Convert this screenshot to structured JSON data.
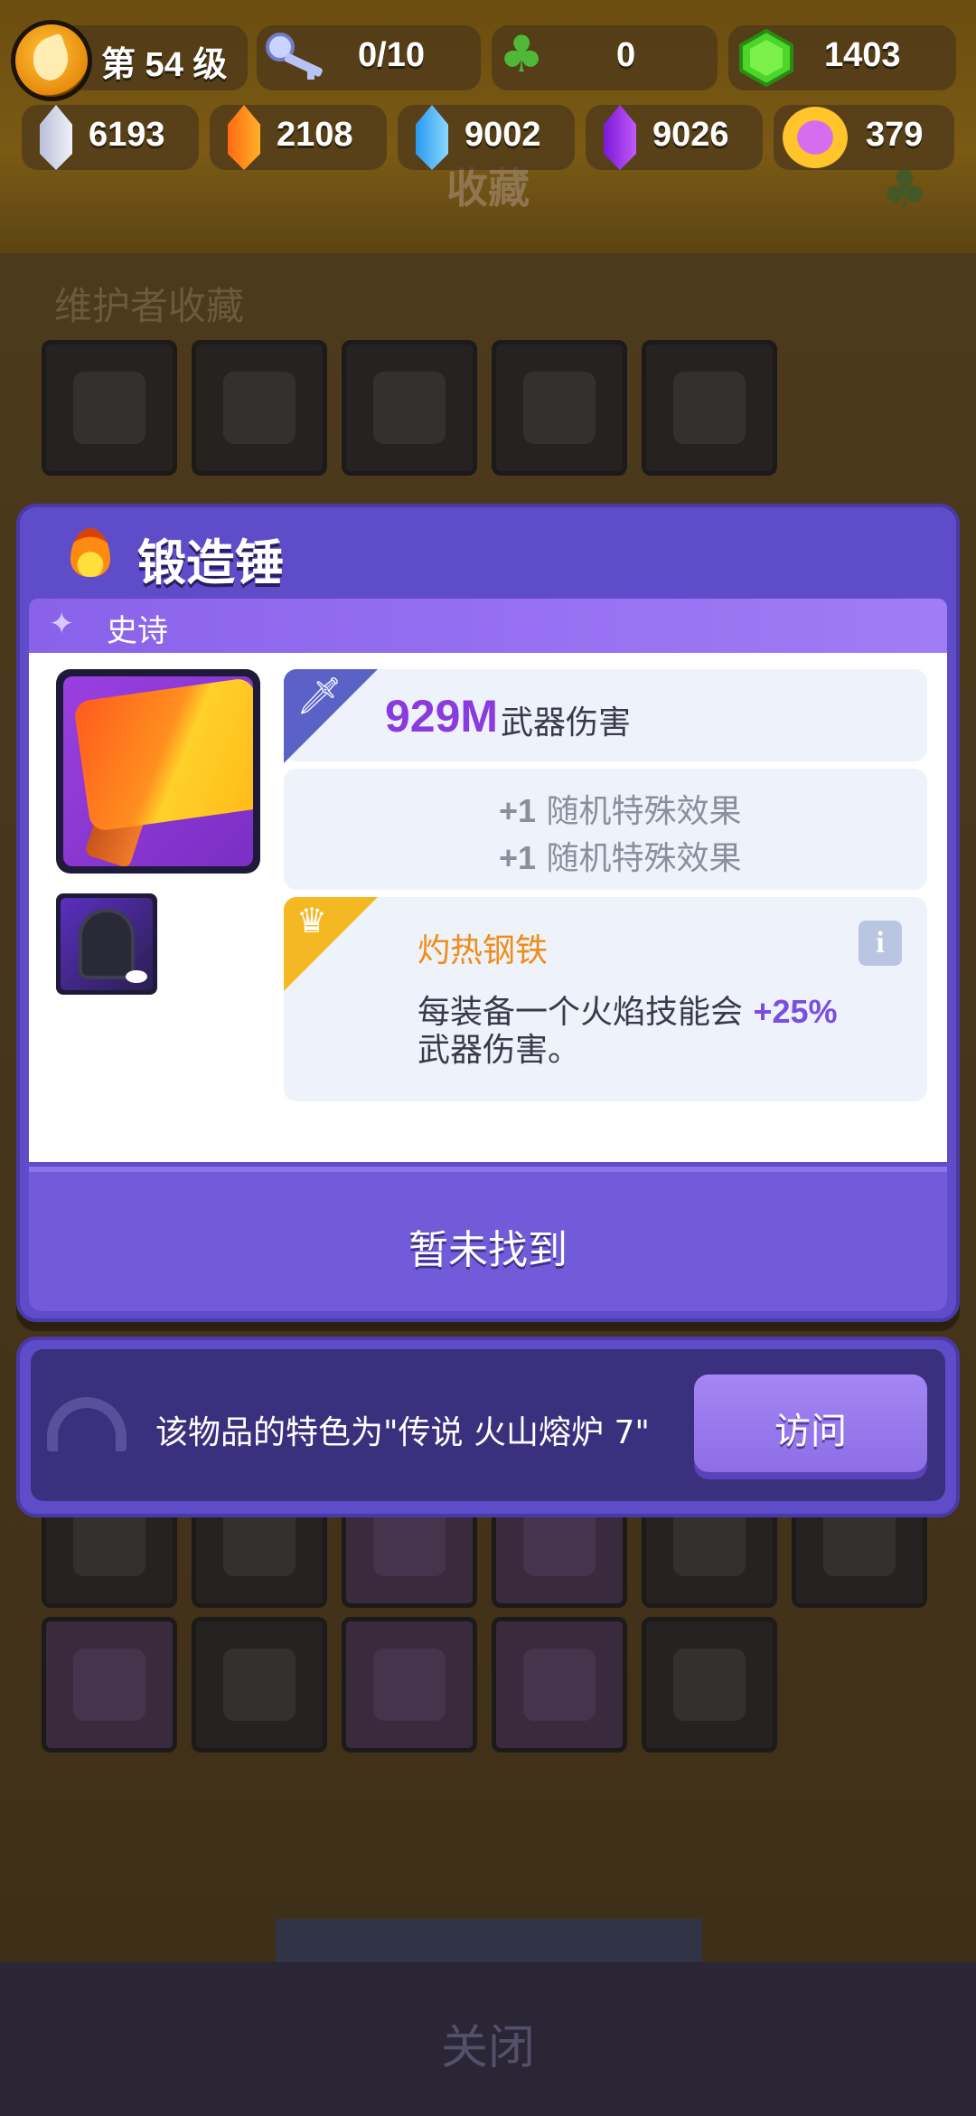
{
  "header": {
    "level_label": "第 54 级",
    "keys": "0/10",
    "clovers": "0",
    "green_gems": "1403"
  },
  "resources": [
    {
      "icon": "silver-crystal-icon",
      "value": "6193"
    },
    {
      "icon": "orange-crystal-icon",
      "value": "2108"
    },
    {
      "icon": "blue-crystal-icon",
      "value": "9002"
    },
    {
      "icon": "purple-crystal-icon",
      "value": "9026"
    },
    {
      "icon": "crown-token-icon",
      "value": "379"
    }
  ],
  "background": {
    "screen_title": "收藏",
    "section_title": "维护者收藏",
    "close_label": "关闭"
  },
  "dialog": {
    "title": "锻造锤",
    "rarity": "史诗",
    "weapon_damage_value": "929M",
    "weapon_damage_label": "武器伤害",
    "bonus_lines": [
      {
        "amount": "+1",
        "text": "随机特殊效果"
      },
      {
        "amount": "+1",
        "text": "随机特殊效果"
      }
    ],
    "perk_name": "灼热钢铁",
    "perk_desc_prefix": "每装备一个火焰技能会",
    "perk_desc_value": "+25%",
    "perk_desc_suffix": "武器伤害。",
    "not_found_label": "暂未找到"
  },
  "source": {
    "text": "该物品的特色为\"传说 火山熔炉 7\"",
    "visit_label": "访问"
  },
  "colors": {
    "dialog_purple": "#5f4cc9",
    "rarity_purple": "#8a62ea",
    "damage_value": "#8a3be0",
    "perk_orange": "#f08c18",
    "visit_button": "#9a7cf0"
  }
}
